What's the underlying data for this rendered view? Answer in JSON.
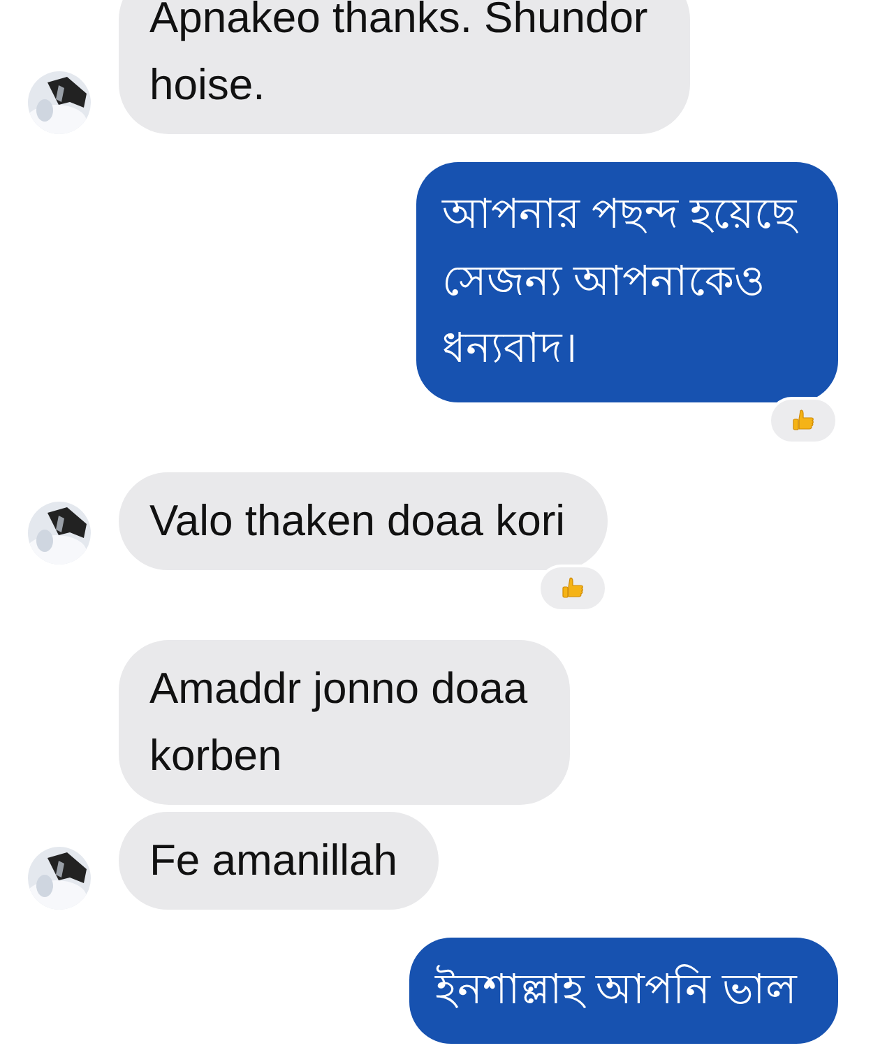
{
  "messages": [
    {
      "kind": "incoming",
      "avatar": true,
      "lines": [
        "Apnakeo thanks. Shundor",
        "hoise."
      ]
    },
    {
      "kind": "outgoing",
      "lines": [
        "আপনার পছন্দ হয়েছে",
        "সেজন্য আপনাকেও",
        "ধন্যবাদ।"
      ],
      "reaction": {
        "kind": "like"
      }
    },
    {
      "kind": "incoming",
      "avatar": true,
      "lines": [
        "Valo thaken doaa kori"
      ],
      "reaction": {
        "kind": "like"
      }
    },
    {
      "kind": "incoming",
      "avatar": false,
      "lines": [
        "Amaddr jonno doaa",
        "korben"
      ]
    },
    {
      "kind": "incoming",
      "avatar": true,
      "lines": [
        "Fe amanillah"
      ]
    },
    {
      "kind": "outgoing",
      "lines": [
        "ইনশাল্লাহ আপনি ভাল"
      ]
    }
  ]
}
